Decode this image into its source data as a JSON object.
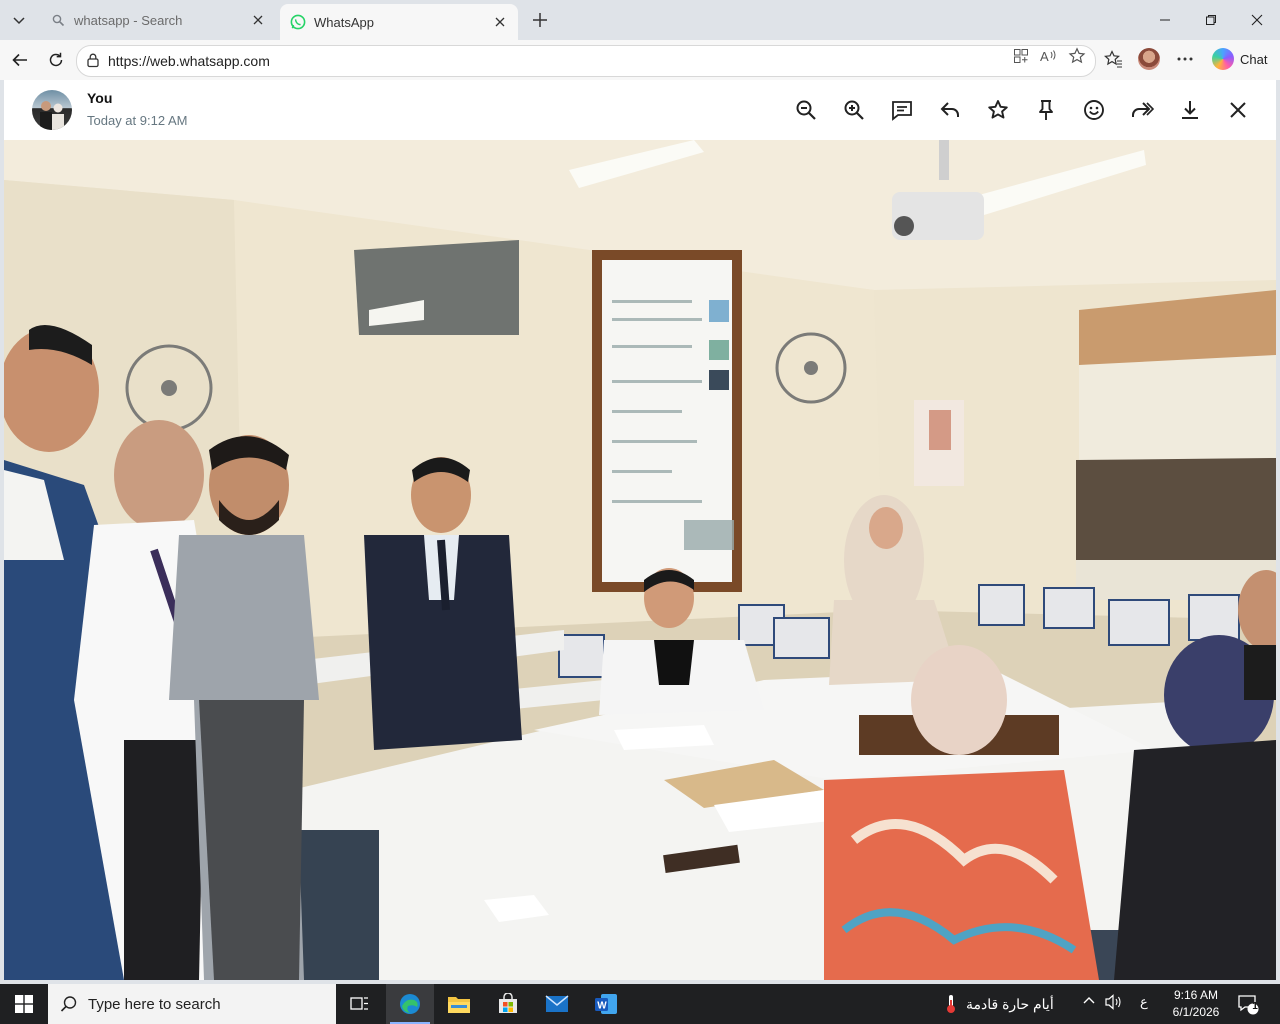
{
  "browser": {
    "tabs": [
      {
        "title": "whatsapp - Search",
        "icon": "search-icon",
        "active": false
      },
      {
        "title": "WhatsApp",
        "icon": "whatsapp-icon",
        "active": true
      }
    ],
    "url": "https://web.whatsapp.com",
    "chat_button_label": "Chat"
  },
  "viewer": {
    "sender": "You",
    "timestamp": "Today at 9:12 AM",
    "actions": [
      "zoom-out",
      "zoom-in",
      "caption",
      "reply",
      "star",
      "pin",
      "react",
      "forward",
      "download",
      "close"
    ]
  },
  "photo": {
    "description_colors": {
      "wall": "#efe6d0",
      "ceiling": "#f3ecdc",
      "table": "#f4f4f2",
      "suit": "#22283a"
    }
  },
  "taskbar": {
    "search_placeholder": "Type here to search",
    "weather_text": "أيام حارة قادمة",
    "language": "ع",
    "time": "9:16 AM",
    "date": "6/1/2026",
    "notification_count": "1"
  },
  "colors": {
    "accent": "#25d366",
    "taskbar": "#1f2022",
    "tabstrip": "#dfe3e8"
  }
}
